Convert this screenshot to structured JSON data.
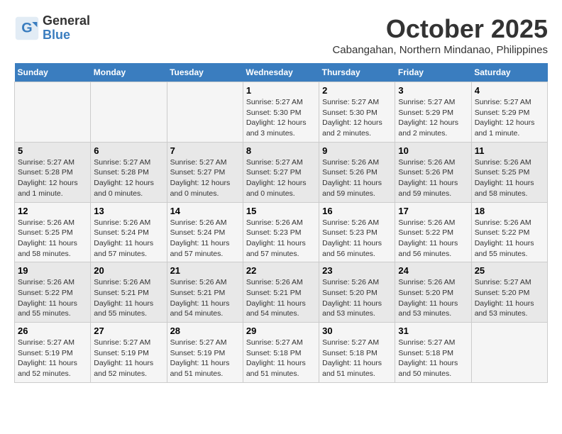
{
  "header": {
    "logo_line1": "General",
    "logo_line2": "Blue",
    "month": "October 2025",
    "location": "Cabangahan, Northern Mindanao, Philippines"
  },
  "weekdays": [
    "Sunday",
    "Monday",
    "Tuesday",
    "Wednesday",
    "Thursday",
    "Friday",
    "Saturday"
  ],
  "weeks": [
    [
      {
        "day": "",
        "info": ""
      },
      {
        "day": "",
        "info": ""
      },
      {
        "day": "",
        "info": ""
      },
      {
        "day": "1",
        "info": "Sunrise: 5:27 AM\nSunset: 5:30 PM\nDaylight: 12 hours and 3 minutes."
      },
      {
        "day": "2",
        "info": "Sunrise: 5:27 AM\nSunset: 5:30 PM\nDaylight: 12 hours and 2 minutes."
      },
      {
        "day": "3",
        "info": "Sunrise: 5:27 AM\nSunset: 5:29 PM\nDaylight: 12 hours and 2 minutes."
      },
      {
        "day": "4",
        "info": "Sunrise: 5:27 AM\nSunset: 5:29 PM\nDaylight: 12 hours and 1 minute."
      }
    ],
    [
      {
        "day": "5",
        "info": "Sunrise: 5:27 AM\nSunset: 5:28 PM\nDaylight: 12 hours and 1 minute."
      },
      {
        "day": "6",
        "info": "Sunrise: 5:27 AM\nSunset: 5:28 PM\nDaylight: 12 hours and 0 minutes."
      },
      {
        "day": "7",
        "info": "Sunrise: 5:27 AM\nSunset: 5:27 PM\nDaylight: 12 hours and 0 minutes."
      },
      {
        "day": "8",
        "info": "Sunrise: 5:27 AM\nSunset: 5:27 PM\nDaylight: 12 hours and 0 minutes."
      },
      {
        "day": "9",
        "info": "Sunrise: 5:26 AM\nSunset: 5:26 PM\nDaylight: 11 hours and 59 minutes."
      },
      {
        "day": "10",
        "info": "Sunrise: 5:26 AM\nSunset: 5:26 PM\nDaylight: 11 hours and 59 minutes."
      },
      {
        "day": "11",
        "info": "Sunrise: 5:26 AM\nSunset: 5:25 PM\nDaylight: 11 hours and 58 minutes."
      }
    ],
    [
      {
        "day": "12",
        "info": "Sunrise: 5:26 AM\nSunset: 5:25 PM\nDaylight: 11 hours and 58 minutes."
      },
      {
        "day": "13",
        "info": "Sunrise: 5:26 AM\nSunset: 5:24 PM\nDaylight: 11 hours and 57 minutes."
      },
      {
        "day": "14",
        "info": "Sunrise: 5:26 AM\nSunset: 5:24 PM\nDaylight: 11 hours and 57 minutes."
      },
      {
        "day": "15",
        "info": "Sunrise: 5:26 AM\nSunset: 5:23 PM\nDaylight: 11 hours and 57 minutes."
      },
      {
        "day": "16",
        "info": "Sunrise: 5:26 AM\nSunset: 5:23 PM\nDaylight: 11 hours and 56 minutes."
      },
      {
        "day": "17",
        "info": "Sunrise: 5:26 AM\nSunset: 5:22 PM\nDaylight: 11 hours and 56 minutes."
      },
      {
        "day": "18",
        "info": "Sunrise: 5:26 AM\nSunset: 5:22 PM\nDaylight: 11 hours and 55 minutes."
      }
    ],
    [
      {
        "day": "19",
        "info": "Sunrise: 5:26 AM\nSunset: 5:22 PM\nDaylight: 11 hours and 55 minutes."
      },
      {
        "day": "20",
        "info": "Sunrise: 5:26 AM\nSunset: 5:21 PM\nDaylight: 11 hours and 55 minutes."
      },
      {
        "day": "21",
        "info": "Sunrise: 5:26 AM\nSunset: 5:21 PM\nDaylight: 11 hours and 54 minutes."
      },
      {
        "day": "22",
        "info": "Sunrise: 5:26 AM\nSunset: 5:21 PM\nDaylight: 11 hours and 54 minutes."
      },
      {
        "day": "23",
        "info": "Sunrise: 5:26 AM\nSunset: 5:20 PM\nDaylight: 11 hours and 53 minutes."
      },
      {
        "day": "24",
        "info": "Sunrise: 5:26 AM\nSunset: 5:20 PM\nDaylight: 11 hours and 53 minutes."
      },
      {
        "day": "25",
        "info": "Sunrise: 5:27 AM\nSunset: 5:20 PM\nDaylight: 11 hours and 53 minutes."
      }
    ],
    [
      {
        "day": "26",
        "info": "Sunrise: 5:27 AM\nSunset: 5:19 PM\nDaylight: 11 hours and 52 minutes."
      },
      {
        "day": "27",
        "info": "Sunrise: 5:27 AM\nSunset: 5:19 PM\nDaylight: 11 hours and 52 minutes."
      },
      {
        "day": "28",
        "info": "Sunrise: 5:27 AM\nSunset: 5:19 PM\nDaylight: 11 hours and 51 minutes."
      },
      {
        "day": "29",
        "info": "Sunrise: 5:27 AM\nSunset: 5:18 PM\nDaylight: 11 hours and 51 minutes."
      },
      {
        "day": "30",
        "info": "Sunrise: 5:27 AM\nSunset: 5:18 PM\nDaylight: 11 hours and 51 minutes."
      },
      {
        "day": "31",
        "info": "Sunrise: 5:27 AM\nSunset: 5:18 PM\nDaylight: 11 hours and 50 minutes."
      },
      {
        "day": "",
        "info": ""
      }
    ]
  ]
}
